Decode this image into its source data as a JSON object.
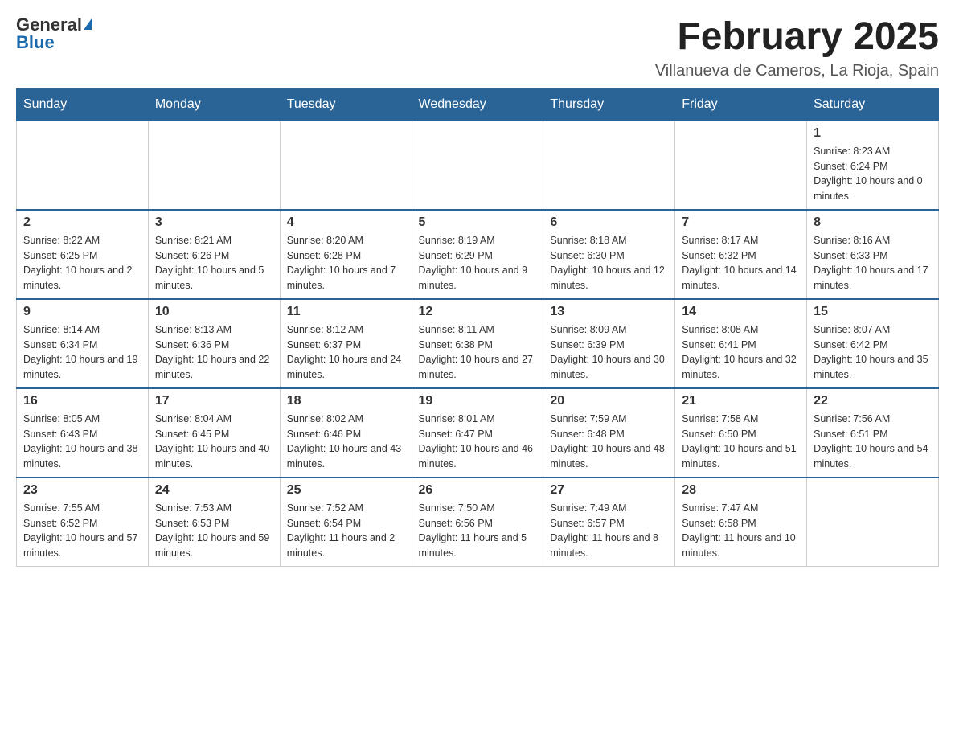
{
  "header": {
    "logo": {
      "general": "General",
      "blue": "Blue"
    },
    "title": "February 2025",
    "location": "Villanueva de Cameros, La Rioja, Spain"
  },
  "weekdays": [
    "Sunday",
    "Monday",
    "Tuesday",
    "Wednesday",
    "Thursday",
    "Friday",
    "Saturday"
  ],
  "weeks": [
    [
      {
        "day": "",
        "info": ""
      },
      {
        "day": "",
        "info": ""
      },
      {
        "day": "",
        "info": ""
      },
      {
        "day": "",
        "info": ""
      },
      {
        "day": "",
        "info": ""
      },
      {
        "day": "",
        "info": ""
      },
      {
        "day": "1",
        "info": "Sunrise: 8:23 AM\nSunset: 6:24 PM\nDaylight: 10 hours and 0 minutes."
      }
    ],
    [
      {
        "day": "2",
        "info": "Sunrise: 8:22 AM\nSunset: 6:25 PM\nDaylight: 10 hours and 2 minutes."
      },
      {
        "day": "3",
        "info": "Sunrise: 8:21 AM\nSunset: 6:26 PM\nDaylight: 10 hours and 5 minutes."
      },
      {
        "day": "4",
        "info": "Sunrise: 8:20 AM\nSunset: 6:28 PM\nDaylight: 10 hours and 7 minutes."
      },
      {
        "day": "5",
        "info": "Sunrise: 8:19 AM\nSunset: 6:29 PM\nDaylight: 10 hours and 9 minutes."
      },
      {
        "day": "6",
        "info": "Sunrise: 8:18 AM\nSunset: 6:30 PM\nDaylight: 10 hours and 12 minutes."
      },
      {
        "day": "7",
        "info": "Sunrise: 8:17 AM\nSunset: 6:32 PM\nDaylight: 10 hours and 14 minutes."
      },
      {
        "day": "8",
        "info": "Sunrise: 8:16 AM\nSunset: 6:33 PM\nDaylight: 10 hours and 17 minutes."
      }
    ],
    [
      {
        "day": "9",
        "info": "Sunrise: 8:14 AM\nSunset: 6:34 PM\nDaylight: 10 hours and 19 minutes."
      },
      {
        "day": "10",
        "info": "Sunrise: 8:13 AM\nSunset: 6:36 PM\nDaylight: 10 hours and 22 minutes."
      },
      {
        "day": "11",
        "info": "Sunrise: 8:12 AM\nSunset: 6:37 PM\nDaylight: 10 hours and 24 minutes."
      },
      {
        "day": "12",
        "info": "Sunrise: 8:11 AM\nSunset: 6:38 PM\nDaylight: 10 hours and 27 minutes."
      },
      {
        "day": "13",
        "info": "Sunrise: 8:09 AM\nSunset: 6:39 PM\nDaylight: 10 hours and 30 minutes."
      },
      {
        "day": "14",
        "info": "Sunrise: 8:08 AM\nSunset: 6:41 PM\nDaylight: 10 hours and 32 minutes."
      },
      {
        "day": "15",
        "info": "Sunrise: 8:07 AM\nSunset: 6:42 PM\nDaylight: 10 hours and 35 minutes."
      }
    ],
    [
      {
        "day": "16",
        "info": "Sunrise: 8:05 AM\nSunset: 6:43 PM\nDaylight: 10 hours and 38 minutes."
      },
      {
        "day": "17",
        "info": "Sunrise: 8:04 AM\nSunset: 6:45 PM\nDaylight: 10 hours and 40 minutes."
      },
      {
        "day": "18",
        "info": "Sunrise: 8:02 AM\nSunset: 6:46 PM\nDaylight: 10 hours and 43 minutes."
      },
      {
        "day": "19",
        "info": "Sunrise: 8:01 AM\nSunset: 6:47 PM\nDaylight: 10 hours and 46 minutes."
      },
      {
        "day": "20",
        "info": "Sunrise: 7:59 AM\nSunset: 6:48 PM\nDaylight: 10 hours and 48 minutes."
      },
      {
        "day": "21",
        "info": "Sunrise: 7:58 AM\nSunset: 6:50 PM\nDaylight: 10 hours and 51 minutes."
      },
      {
        "day": "22",
        "info": "Sunrise: 7:56 AM\nSunset: 6:51 PM\nDaylight: 10 hours and 54 minutes."
      }
    ],
    [
      {
        "day": "23",
        "info": "Sunrise: 7:55 AM\nSunset: 6:52 PM\nDaylight: 10 hours and 57 minutes."
      },
      {
        "day": "24",
        "info": "Sunrise: 7:53 AM\nSunset: 6:53 PM\nDaylight: 10 hours and 59 minutes."
      },
      {
        "day": "25",
        "info": "Sunrise: 7:52 AM\nSunset: 6:54 PM\nDaylight: 11 hours and 2 minutes."
      },
      {
        "day": "26",
        "info": "Sunrise: 7:50 AM\nSunset: 6:56 PM\nDaylight: 11 hours and 5 minutes."
      },
      {
        "day": "27",
        "info": "Sunrise: 7:49 AM\nSunset: 6:57 PM\nDaylight: 11 hours and 8 minutes."
      },
      {
        "day": "28",
        "info": "Sunrise: 7:47 AM\nSunset: 6:58 PM\nDaylight: 11 hours and 10 minutes."
      },
      {
        "day": "",
        "info": ""
      }
    ]
  ]
}
